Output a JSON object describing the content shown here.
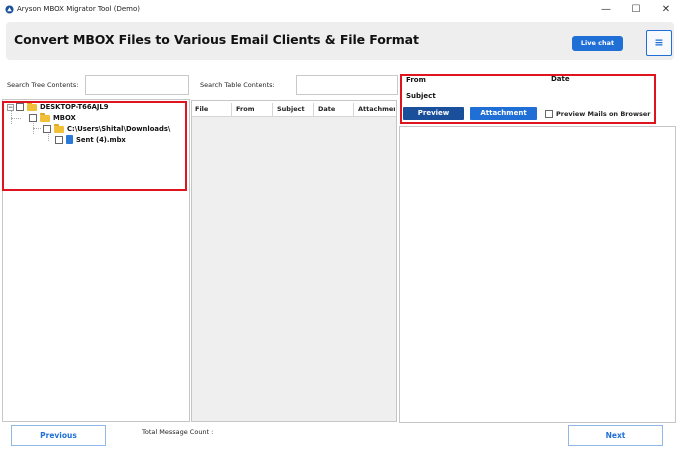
{
  "window": {
    "title": "Aryson MBOX Migrator Tool (Demo)",
    "minimize_glyph": "—",
    "maximize_glyph": "☐",
    "close_glyph": "✕"
  },
  "header": {
    "title": "Convert MBOX Files to Various Email Clients & File Format",
    "live_chat_label": "Live chat",
    "menu_glyph": "≡"
  },
  "search": {
    "tree_label": "Search Tree Contents:",
    "tree_value": "",
    "table_label": "Search Table Contents:",
    "table_value": ""
  },
  "tree": {
    "items": [
      {
        "label": "DESKTOP-T66AJL9",
        "icon": "folder-icon"
      },
      {
        "label": "MBOX",
        "icon": "folder-icon"
      },
      {
        "label": "C:\\Users\\Shital\\Downloads\\",
        "icon": "folder-icon"
      },
      {
        "label": "Sent (4).mbx",
        "icon": "file-icon"
      }
    ]
  },
  "table": {
    "columns": [
      "File",
      "From",
      "Subject",
      "Date",
      "Attachment"
    ]
  },
  "mail_header": {
    "from_label": "From",
    "date_label": "Date",
    "subject_label": "Subject",
    "preview_button": "Preview",
    "attachment_button": "Attachment",
    "preview_browser_label": "Preview Mails on Browser"
  },
  "footer": {
    "previous_label": "Previous",
    "next_label": "Next",
    "total_label": "Total Message Count :"
  },
  "colors": {
    "accent": "#1f6fd6",
    "highlight": "#e0141e"
  }
}
